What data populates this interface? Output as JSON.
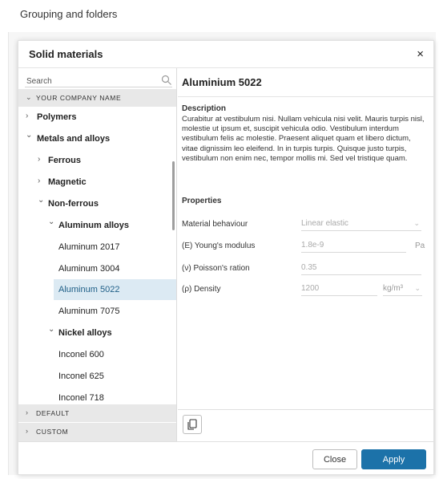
{
  "page": {
    "heading": "Grouping and folders"
  },
  "dialog": {
    "title": "Solid materials",
    "close_glyph": "×",
    "search_placeholder": "Search",
    "groups": {
      "company": "YOUR COMPANY NAME",
      "default": "DEFAULT",
      "custom": "CUSTOM"
    },
    "tree": [
      {
        "label": "Polymers",
        "chev": "›"
      },
      {
        "label": "Metals and alloys",
        "chev": "⌄"
      },
      {
        "label": "Ferrous",
        "chev": "›"
      },
      {
        "label": "Magnetic",
        "chev": "›"
      },
      {
        "label": "Non-ferrous",
        "chev": "⌄"
      },
      {
        "label": "Aluminum alloys",
        "chev": "⌄"
      },
      {
        "label": "Aluminum 2017"
      },
      {
        "label": "Aluminum 3004"
      },
      {
        "label": "Aluminum 5022"
      },
      {
        "label": "Aluminum 7075"
      },
      {
        "label": "Nickel alloys",
        "chev": "⌄"
      },
      {
        "label": "Inconel 600"
      },
      {
        "label": "Inconel 625"
      },
      {
        "label": "Inconel 718"
      }
    ],
    "material": {
      "title": "Aluminium 5022",
      "description_label": "Description",
      "description": "Curabitur at vestibulum nisi. Nullam vehicula nisi velit. Mauris turpis nisl, molestie ut ipsum et, suscipit vehicula odio. Vestibulum interdum vestibulum felis ac molestie. Praesent aliquet quam et libero dictum, vitae dignissim leo eleifend. In in turpis turpis. Quisque justo turpis, vestibulum non enim nec, tempor mollis mi. Sed vel tristique quam.",
      "properties_label": "Properties",
      "behaviour": {
        "label": "Material behaviour",
        "value": "Linear elastic"
      },
      "youngs": {
        "label": "(E) Young's modulus",
        "value": "1.8e-9",
        "unit": "Pa"
      },
      "poisson": {
        "label": "(ν) Poisson's ration",
        "value": "0.35"
      },
      "density": {
        "label": "(ρ) Density",
        "value": "1200",
        "unit": "kg/m³"
      }
    },
    "buttons": {
      "close": "Close",
      "apply": "Apply"
    }
  }
}
